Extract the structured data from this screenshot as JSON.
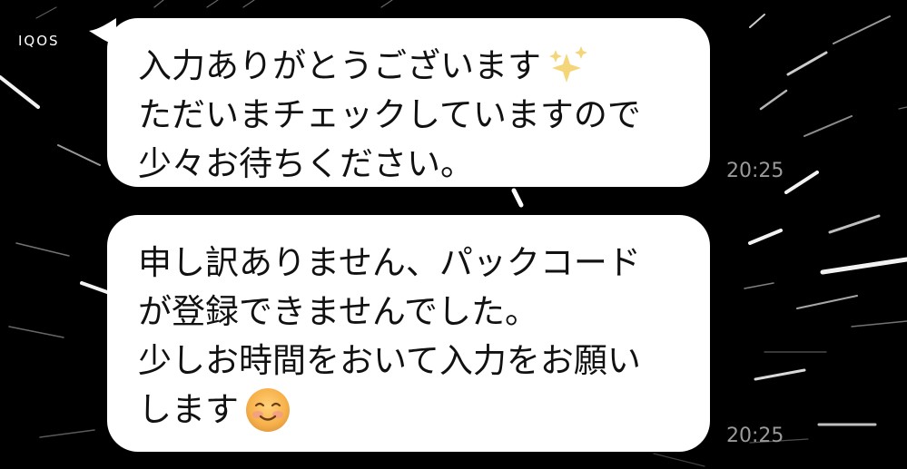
{
  "sender": {
    "name": "IQOS"
  },
  "messages": [
    {
      "lines": [
        "入力ありがとうございます",
        "ただいまチェックしていますので",
        "少々お待ちください。"
      ],
      "time": "20:25",
      "emoji": "sparkles"
    },
    {
      "lines": [
        "申し訳ありません、パックコード",
        "が登録できませんでした。",
        "少しお時間をおいて入力をお願い",
        "します"
      ],
      "time": "20:25",
      "emoji": "smiling-face-blush"
    }
  ],
  "colors": {
    "background": "#000000",
    "bubble": "#ffffff",
    "text": "#111111",
    "timestamp": "#9a9a9a"
  }
}
